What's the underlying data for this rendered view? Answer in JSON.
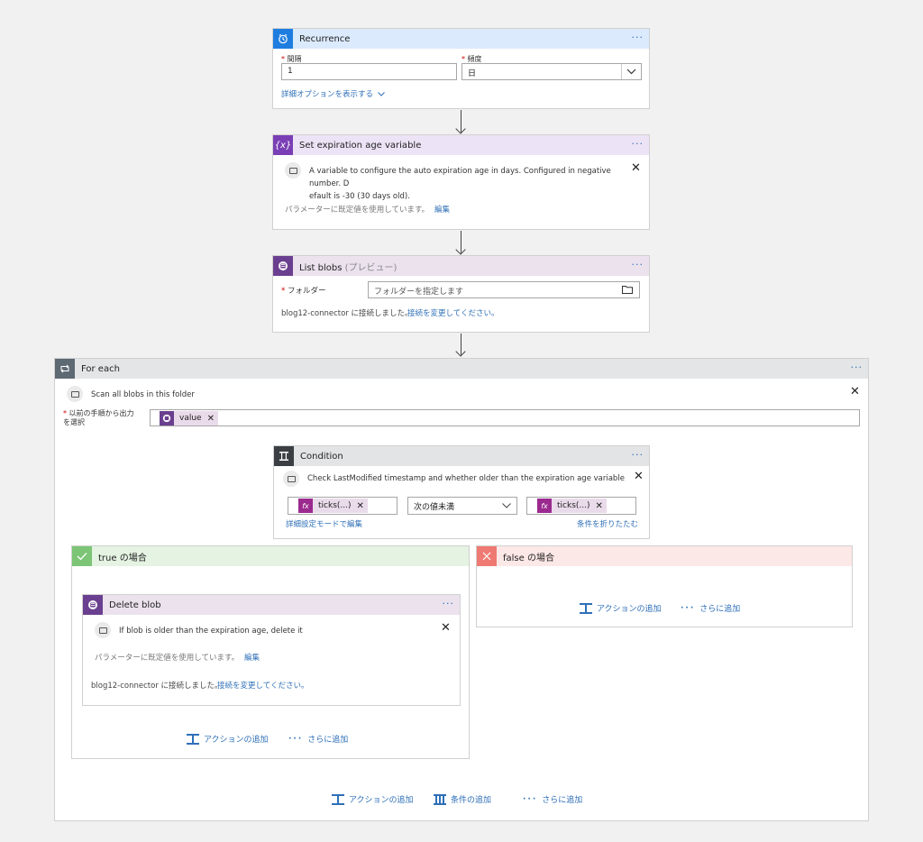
{
  "colors": {
    "recurrence": "#1f7de0",
    "variable": "#7a3fb5",
    "blob": "#6b3f8f",
    "foreach": "#5d6973",
    "condition": "#3b3f44",
    "true": "#7cc576",
    "false": "#ef7a73",
    "link": "#2e6fb7"
  },
  "recurrence": {
    "title": "Recurrence",
    "icon": "alarm-clock-icon",
    "interval_label": "間隔",
    "interval_value": "1",
    "frequency_label": "頻度",
    "frequency_value": "日",
    "advanced_link": "詳細オプションを表示する"
  },
  "set_variable": {
    "title": "Set expiration age variable",
    "icon": "variable-icon",
    "comment": "A variable to configure the auto expiration age in days. Configured in negative number. Default is -30 (30 days old).",
    "comment_line1": "A variable to configure the auto expiration age in days. Configured in negative number. D",
    "comment_line2": "efault is -30 (30 days old).",
    "defaults_text": "パラメーターに既定値を使用しています。",
    "edit_link": "編集"
  },
  "list_blobs": {
    "title": "List blobs",
    "title_suffix": "(プレビュー)",
    "icon": "blob-storage-icon",
    "folder_label": "フォルダー",
    "folder_placeholder": "フォルダーを指定します",
    "connection_text": "blog12-connector に接続しました。",
    "change_connection_link": "接続を変更してください。"
  },
  "for_each": {
    "title": "For each",
    "icon": "loop-icon",
    "comment": "Scan all blobs in this folder",
    "select_label_line1": "以前の手順から出力",
    "select_label_line2": "を選択",
    "token_label": "value",
    "add_action": "アクションの追加",
    "add_condition": "条件の追加",
    "add_more": "さらに追加"
  },
  "condition": {
    "title": "Condition",
    "icon": "condition-icon",
    "comment": "Check LastModified timestamp and whether older than the expiration age variable",
    "left_token": "ticks(...)",
    "operator": "次の値未満",
    "right_token": "ticks(...)",
    "advanced_mode_link": "詳細設定モードで編集",
    "collapse_link": "条件を折りたたむ"
  },
  "true_branch": {
    "title": "true の場合",
    "add_action": "アクションの追加",
    "add_more": "さらに追加"
  },
  "false_branch": {
    "title": "false の場合",
    "add_action": "アクションの追加",
    "add_more": "さらに追加"
  },
  "delete_blob": {
    "title": "Delete blob",
    "icon": "blob-storage-icon",
    "comment": "If blob is older than the expiration age, delete it",
    "defaults_text": "パラメーターに既定値を使用しています。",
    "edit_link": "編集",
    "connection_text": "blog12-connector に接続しました。",
    "change_connection_link": "接続を変更してください。"
  }
}
